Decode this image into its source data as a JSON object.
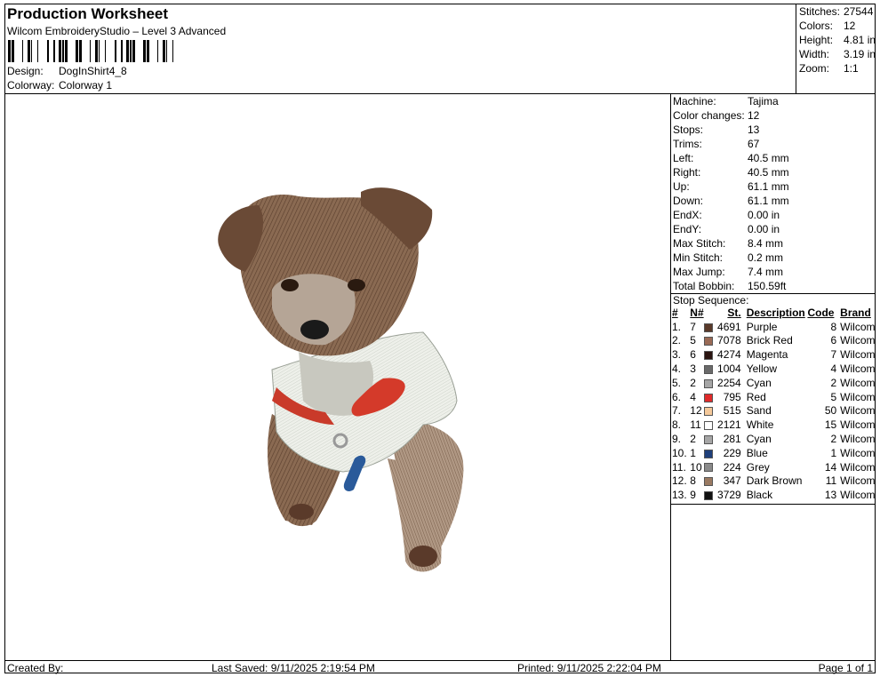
{
  "header": {
    "title": "Production Worksheet",
    "subtitle": "Wilcom EmbroideryStudio – Level 3 Advanced",
    "design_label": "Design:",
    "design_value": "DogInShirt4_8",
    "colorway_label": "Colorway:",
    "colorway_value": "Colorway 1"
  },
  "summary": [
    {
      "label": "Stitches:",
      "value": "27544"
    },
    {
      "label": "Colors:",
      "value": "12"
    },
    {
      "label": "Height:",
      "value": "4.81 in"
    },
    {
      "label": "Width:",
      "value": "3.19 in"
    },
    {
      "label": "Zoom:",
      "value": "1:1"
    }
  ],
  "machine_info": [
    {
      "label": "Machine:",
      "value": "Tajima"
    },
    {
      "label": "Color changes:",
      "value": "12"
    },
    {
      "label": "Stops:",
      "value": "13"
    },
    {
      "label": "Trims:",
      "value": "67"
    },
    {
      "label": "Left:",
      "value": "40.5 mm"
    },
    {
      "label": "Right:",
      "value": "40.5 mm"
    },
    {
      "label": "Up:",
      "value": "61.1 mm"
    },
    {
      "label": "Down:",
      "value": "61.1 mm"
    },
    {
      "label": "EndX:",
      "value": "0.00 in"
    },
    {
      "label": "EndY:",
      "value": "0.00 in"
    },
    {
      "label": "Max Stitch:",
      "value": "8.4 mm"
    },
    {
      "label": "Min Stitch:",
      "value": "0.2 mm"
    },
    {
      "label": "Max Jump:",
      "value": "7.4 mm"
    },
    {
      "label": "Total Bobbin:",
      "value": "150.59ft"
    }
  ],
  "stop_sequence": {
    "title": "Stop Sequence:",
    "headers": {
      "idx": "#",
      "n": "N#",
      "st": "St.",
      "desc": "Description",
      "code": "Code",
      "brand": "Brand"
    },
    "rows": [
      {
        "idx": "1.",
        "n": "7",
        "color": "#5a3a2a",
        "st": "4691",
        "desc": "Purple",
        "code": "8",
        "brand": "Wilcom"
      },
      {
        "idx": "2.",
        "n": "5",
        "color": "#9a6a55",
        "st": "7078",
        "desc": "Brick Red",
        "code": "6",
        "brand": "Wilcom"
      },
      {
        "idx": "3.",
        "n": "6",
        "color": "#2a1410",
        "st": "4274",
        "desc": "Magenta",
        "code": "7",
        "brand": "Wilcom"
      },
      {
        "idx": "4.",
        "n": "3",
        "color": "#6a6a6a",
        "st": "1004",
        "desc": "Yellow",
        "code": "4",
        "brand": "Wilcom"
      },
      {
        "idx": "5.",
        "n": "2",
        "color": "#a6a6a6",
        "st": "2254",
        "desc": "Cyan",
        "code": "2",
        "brand": "Wilcom"
      },
      {
        "idx": "6.",
        "n": "4",
        "color": "#e02a2a",
        "st": "795",
        "desc": "Red",
        "code": "5",
        "brand": "Wilcom"
      },
      {
        "idx": "7.",
        "n": "12",
        "color": "#f5c99a",
        "st": "515",
        "desc": "Sand",
        "code": "50",
        "brand": "Wilcom"
      },
      {
        "idx": "8.",
        "n": "11",
        "color": "#ffffff",
        "st": "2121",
        "desc": "White",
        "code": "15",
        "brand": "Wilcom"
      },
      {
        "idx": "9.",
        "n": "2",
        "color": "#a6a6a6",
        "st": "281",
        "desc": "Cyan",
        "code": "2",
        "brand": "Wilcom"
      },
      {
        "idx": "10.",
        "n": "1",
        "color": "#1f3f7a",
        "st": "229",
        "desc": "Blue",
        "code": "1",
        "brand": "Wilcom"
      },
      {
        "idx": "11.",
        "n": "10",
        "color": "#8a8a8a",
        "st": "224",
        "desc": "Grey",
        "code": "14",
        "brand": "Wilcom"
      },
      {
        "idx": "12.",
        "n": "8",
        "color": "#9a7a62",
        "st": "347",
        "desc": "Dark Brown",
        "code": "11",
        "brand": "Wilcom"
      },
      {
        "idx": "13.",
        "n": "9",
        "color": "#111111",
        "st": "3729",
        "desc": "Black",
        "code": "13",
        "brand": "Wilcom"
      }
    ]
  },
  "footer": {
    "created_by": "Created By:",
    "last_saved": "Last Saved: 9/11/2025 2:19:54 PM",
    "printed": "Printed: 9/11/2025 2:22:04 PM",
    "page": "Page 1 of 1"
  }
}
